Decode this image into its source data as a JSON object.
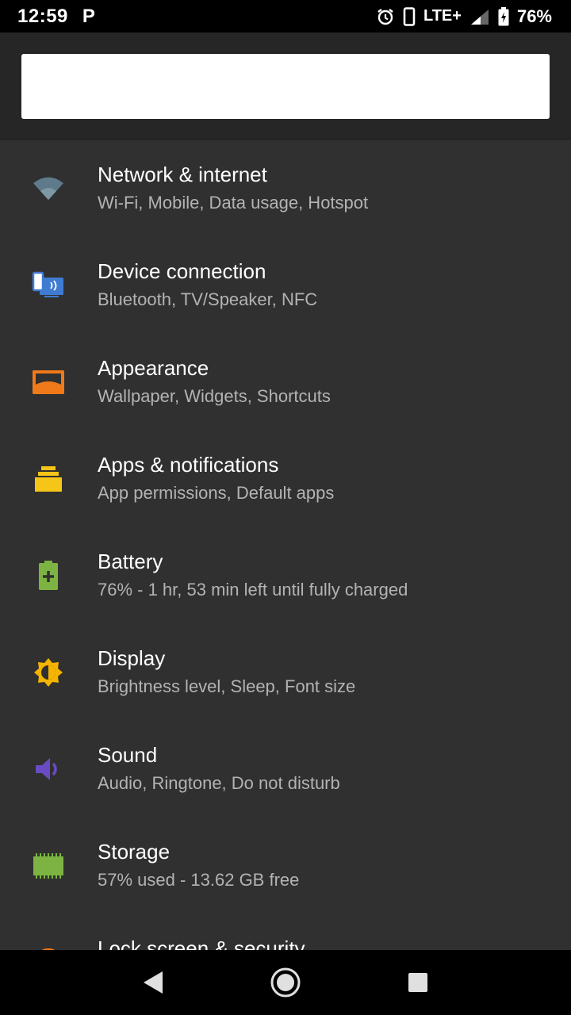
{
  "status_bar": {
    "time": "12:59",
    "notification_icon": "P",
    "network": "LTE+",
    "battery": "76%"
  },
  "search": {
    "placeholder": ""
  },
  "settings": [
    {
      "title": "Network & internet",
      "subtitle": "Wi-Fi, Mobile, Data usage, Hotspot",
      "icon": "wifi-icon",
      "color": "#5f7a8a"
    },
    {
      "title": "Device connection",
      "subtitle": "Bluetooth, TV/Speaker, NFC",
      "icon": "device-connection-icon",
      "color": "#3f7bd1"
    },
    {
      "title": "Appearance",
      "subtitle": "Wallpaper, Widgets, Shortcuts",
      "icon": "appearance-icon",
      "color": "#f07a1a"
    },
    {
      "title": "Apps & notifications",
      "subtitle": "App permissions, Default apps",
      "icon": "apps-icon",
      "color": "#f5c518"
    },
    {
      "title": "Battery",
      "subtitle": "76% - 1 hr, 53 min left until fully charged",
      "icon": "battery-icon",
      "color": "#7cb342"
    },
    {
      "title": "Display",
      "subtitle": "Brightness level, Sleep, Font size",
      "icon": "display-icon",
      "color": "#f4b400"
    },
    {
      "title": "Sound",
      "subtitle": "Audio, Ringtone, Do not disturb",
      "icon": "sound-icon",
      "color": "#6a4bc4"
    },
    {
      "title": "Storage",
      "subtitle": "57% used - 13.62 GB free",
      "icon": "storage-icon",
      "color": "#7cb342"
    },
    {
      "title": "Lock screen & security",
      "subtitle": "",
      "icon": "lock-icon",
      "color": "#f07a1a"
    }
  ]
}
